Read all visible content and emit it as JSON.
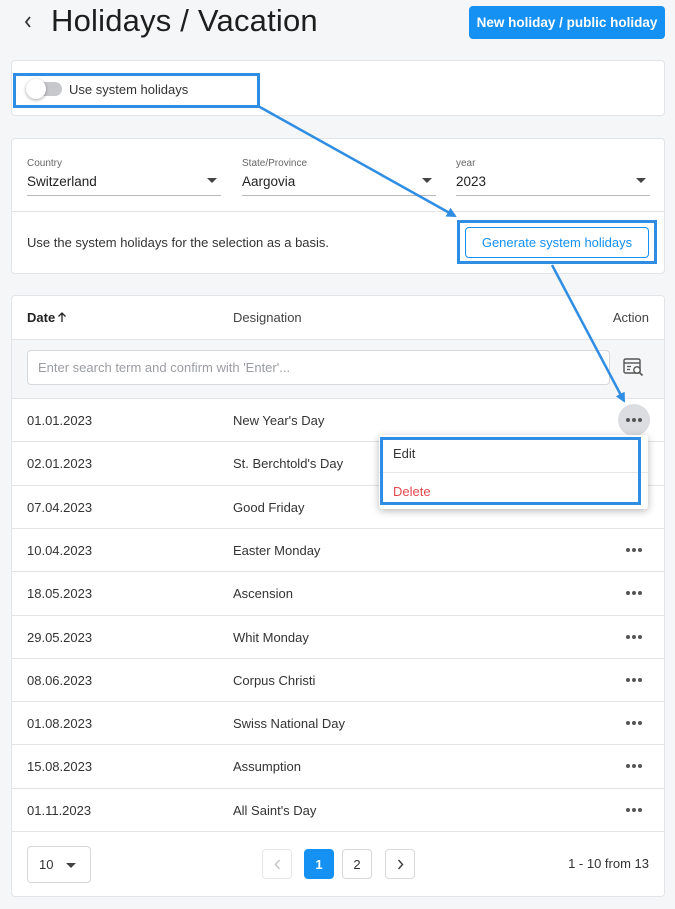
{
  "header": {
    "title": "Holidays / Vacation",
    "new_button": "New holiday / public holiday"
  },
  "toggle": {
    "label": "Use system holidays",
    "on": false
  },
  "filters": {
    "country": {
      "label": "Country",
      "value": "Switzerland"
    },
    "state": {
      "label": "State/Province",
      "value": "Aargovia"
    },
    "year": {
      "label": "year",
      "value": "2023"
    },
    "note": "Use the system holidays for the selection as a basis.",
    "generate_button": "Generate system holidays"
  },
  "table": {
    "columns": {
      "date": "Date",
      "designation": "Designation",
      "action": "Action"
    },
    "search_placeholder": "Enter search term and confirm with 'Enter'...",
    "rows": [
      {
        "date": "01.01.2023",
        "designation": "New Year's Day"
      },
      {
        "date": "02.01.2023",
        "designation": "St. Berchtold's Day"
      },
      {
        "date": "07.04.2023",
        "designation": "Good Friday"
      },
      {
        "date": "10.04.2023",
        "designation": "Easter Monday"
      },
      {
        "date": "18.05.2023",
        "designation": "Ascension"
      },
      {
        "date": "29.05.2023",
        "designation": "Whit Monday"
      },
      {
        "date": "08.06.2023",
        "designation": "Corpus Christi"
      },
      {
        "date": "01.08.2023",
        "designation": "Swiss National Day"
      },
      {
        "date": "15.08.2023",
        "designation": "Assumption"
      },
      {
        "date": "01.11.2023",
        "designation": "All Saint's Day"
      }
    ]
  },
  "action_menu": {
    "edit": "Edit",
    "delete": "Delete"
  },
  "pagination": {
    "page_size": "10",
    "pages": [
      "1",
      "2"
    ],
    "current_page": "1",
    "range_text": "1 - 10 from 13"
  },
  "colors": {
    "accent": "#1590f3",
    "danger": "#e5484d",
    "annotation": "#2f8de4"
  }
}
